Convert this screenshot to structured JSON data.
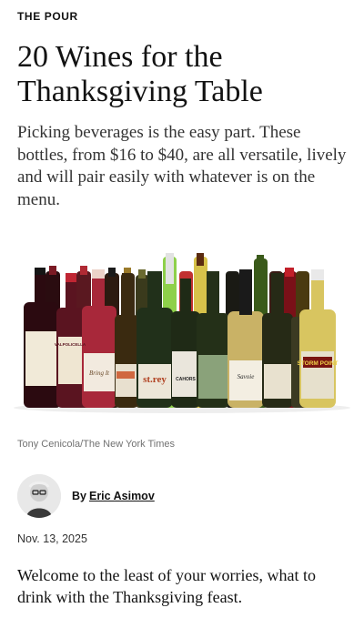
{
  "article": {
    "kicker": "THE POUR",
    "headline": "20 Wines for the Thanksgiving Table",
    "summary": "Picking beverages is the easy part. These bottles, from $16 to $40, are all versatile, lively and will pair easily with whatever is on the menu.",
    "photo_credit": "Tony Cenicola/The New York Times",
    "byline_prefix": "By",
    "author": "Eric Asimov",
    "date": "Nov. 13, 2025",
    "first_paragraph": "Welcome to the least of your worries, what to drink with the Thanksgiving feast."
  },
  "photo": {
    "bottle_labels": [
      "VALPOLICELLA",
      "Bring It",
      "st.rey",
      "CAHORS",
      "Savoie",
      "STORM POINT"
    ],
    "colors": {
      "red_wine": "#3a0f14",
      "white_wine": "#c9b266",
      "green_glass": "#3f4a22",
      "bright_green_glass": "#7fc23a",
      "label_cream": "#efe6d2",
      "backdrop": "#ffffff"
    }
  }
}
